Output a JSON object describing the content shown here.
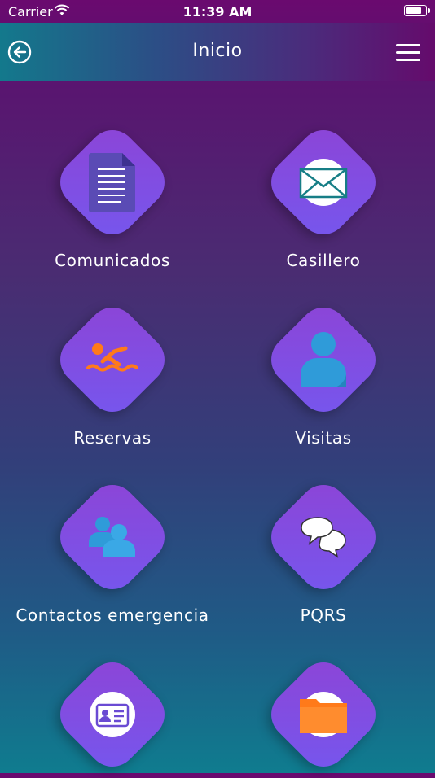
{
  "status_bar": {
    "carrier": "Carrier",
    "time": "11:39 AM"
  },
  "nav": {
    "title": "Inicio",
    "back_icon": "back-circle-icon",
    "menu_icon": "hamburger-menu-icon"
  },
  "tiles": [
    {
      "label": "Comunicados",
      "icon": "document-icon"
    },
    {
      "label": "Casillero",
      "icon": "envelope-icon"
    },
    {
      "label": "Reservas",
      "icon": "swimmer-icon"
    },
    {
      "label": "Visitas",
      "icon": "person-icon"
    },
    {
      "label": "Contactos emergencia",
      "icon": "contacts-icon"
    },
    {
      "label": "PQRS",
      "icon": "chat-bubbles-icon"
    },
    {
      "label": "",
      "icon": "id-card-icon"
    },
    {
      "label": "",
      "icon": "folder-icon"
    }
  ],
  "colors": {
    "tile_top": "#8d44d6",
    "tile_bottom": "#7557ee",
    "accent_orange": "#ff7a1a",
    "accent_blue": "#2f9bd9"
  }
}
